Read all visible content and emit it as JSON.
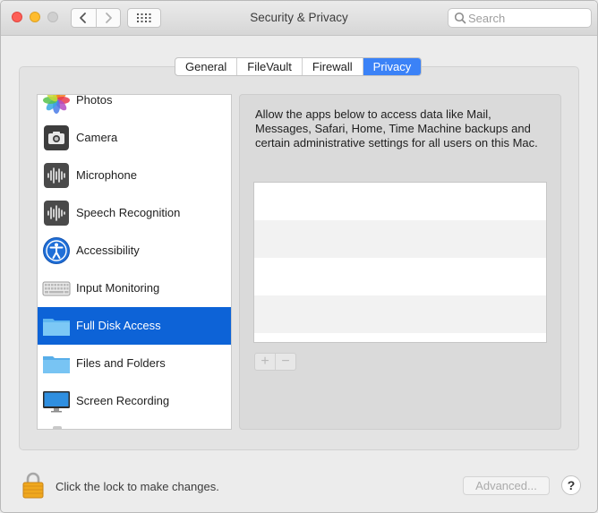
{
  "window": {
    "title": "Security & Privacy"
  },
  "search": {
    "placeholder": "Search"
  },
  "tabs": [
    {
      "label": "General",
      "active": false
    },
    {
      "label": "FileVault",
      "active": false
    },
    {
      "label": "Firewall",
      "active": false
    },
    {
      "label": "Privacy",
      "active": true
    }
  ],
  "privacy_list": [
    {
      "label": "Photos",
      "icon": "photos-icon"
    },
    {
      "label": "Camera",
      "icon": "camera-icon"
    },
    {
      "label": "Microphone",
      "icon": "microphone-icon"
    },
    {
      "label": "Speech Recognition",
      "icon": "speech-recognition-icon"
    },
    {
      "label": "Accessibility",
      "icon": "accessibility-icon"
    },
    {
      "label": "Input Monitoring",
      "icon": "keyboard-icon"
    },
    {
      "label": "Full Disk Access",
      "icon": "folder-icon",
      "selected": true
    },
    {
      "label": "Files and Folders",
      "icon": "folder-icon"
    },
    {
      "label": "Screen Recording",
      "icon": "display-icon"
    }
  ],
  "detail": {
    "description": "Allow the apps below to access data like Mail, Messages, Safari, Home, Time Machine backups and certain administrative settings for all users on this Mac.",
    "add_label": "+",
    "remove_label": "−"
  },
  "footer": {
    "lock_text": "Click the lock to make changes.",
    "advanced_label": "Advanced...",
    "help_label": "?"
  },
  "colors": {
    "accent": "#0d63d7",
    "tab_active": "#3b82f7"
  }
}
